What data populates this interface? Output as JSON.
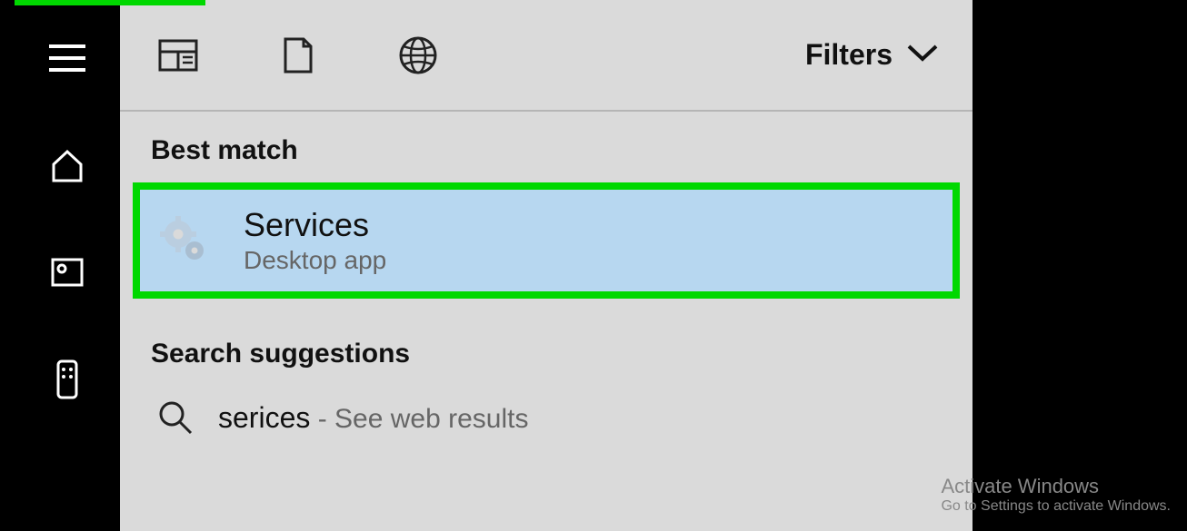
{
  "toolbar": {
    "filters_label": "Filters"
  },
  "best_match": {
    "header": "Best match",
    "title": "Services",
    "subtitle": "Desktop app"
  },
  "suggestions": {
    "header": "Search suggestions",
    "term": "serices",
    "extra": " - See web results"
  },
  "watermark": {
    "title": "Activate Windows",
    "sub": "Go to Settings to activate Windows."
  }
}
